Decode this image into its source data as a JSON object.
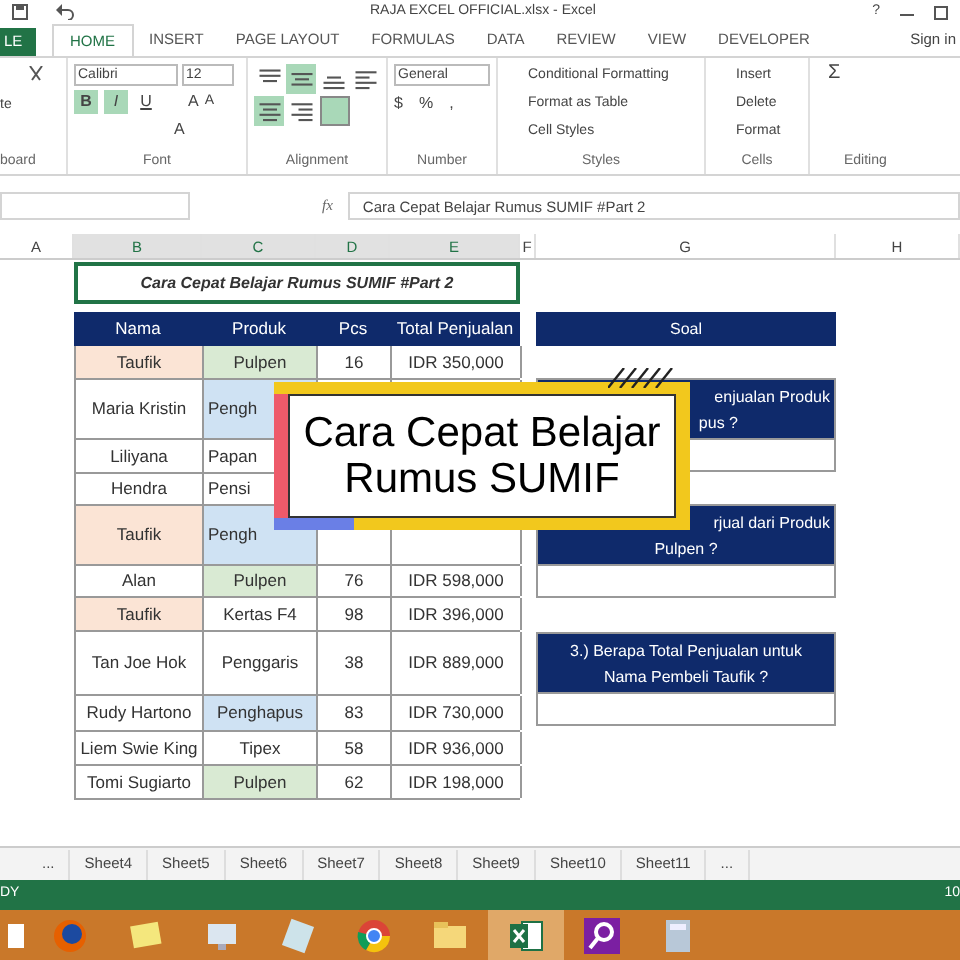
{
  "window": {
    "title": "RAJA EXCEL OFFICIAL.xlsx - Excel",
    "help": "?"
  },
  "file_tab": "LE",
  "tabs": [
    {
      "label": "HOME",
      "selected": true
    },
    {
      "label": "INSERT",
      "selected": false
    },
    {
      "label": "PAGE LAYOUT",
      "selected": false
    },
    {
      "label": "FORMULAS",
      "selected": false
    },
    {
      "label": "DATA",
      "selected": false
    },
    {
      "label": "REVIEW",
      "selected": false
    },
    {
      "label": "VIEW",
      "selected": false
    },
    {
      "label": "DEVELOPER",
      "selected": false
    }
  ],
  "sign_in": "Sign in",
  "ribbon": {
    "paste_label": "te",
    "font_name": "Calibri",
    "font_size": "12",
    "font_buttons": [
      {
        "label": "B",
        "active": true
      },
      {
        "label": "I",
        "active": true
      },
      {
        "label": "U",
        "active": false
      }
    ],
    "font_grow": [
      "A",
      "A"
    ],
    "font_color": "A",
    "align_buttons": [
      {
        "kind": "top",
        "active": false
      },
      {
        "kind": "middle",
        "active": true
      },
      {
        "kind": "bottom",
        "active": false
      },
      {
        "kind": "left",
        "active": false
      },
      {
        "kind": "center",
        "active": true
      },
      {
        "kind": "right",
        "active": false
      }
    ],
    "wrap_active": true,
    "number_format": "General",
    "currency": "$",
    "percent": "%",
    "comma": ",",
    "styles": [
      "Conditional Formatting",
      "Format as Table",
      "Cell Styles"
    ],
    "cells": [
      "Insert",
      "Delete",
      "Format"
    ],
    "autosum": "Σ",
    "groups": [
      "board",
      "Font",
      "Alignment",
      "Number",
      "Styles",
      "Cells",
      "Editing"
    ]
  },
  "function_label": "fx",
  "formula": "Cara Cepat Belajar Rumus SUMIF #Part 2",
  "columns": [
    {
      "label": "A",
      "selected": false
    },
    {
      "label": "B",
      "selected": true
    },
    {
      "label": "C",
      "selected": true
    },
    {
      "label": "D",
      "selected": true
    },
    {
      "label": "E",
      "selected": true
    },
    {
      "label": "F",
      "selected": false
    },
    {
      "label": "G",
      "selected": false
    },
    {
      "label": "H",
      "selected": false
    }
  ],
  "sheet_title": "Cara Cepat Belajar Rumus SUMIF #Part 2",
  "table": {
    "columns": [
      "Nama",
      "Produk",
      "Pcs",
      "Total Penjualan"
    ],
    "rows": [
      {
        "cells": [
          {
            "text": "Taufik",
            "color": "#fbe4d5"
          },
          {
            "text": "Pulpen",
            "color": "#d9ead3"
          },
          {
            "text": "16"
          },
          {
            "text": "IDR 350,000"
          }
        ]
      },
      {
        "cells": [
          {
            "text": "Maria Kristin"
          },
          {
            "text": "Pengh",
            "color": "#cfe2f3"
          },
          null,
          null
        ]
      },
      {
        "cells": [
          {
            "text": "Liliyana"
          },
          {
            "text": "Papan"
          },
          null,
          null
        ]
      },
      {
        "cells": [
          {
            "text": "Hendra"
          },
          {
            "text": "Pensi"
          },
          null,
          null
        ]
      },
      {
        "cells": [
          {
            "text": "Taufik",
            "color": "#fbe4d5"
          },
          {
            "text": "Pengh",
            "color": "#cfe2f3"
          },
          null,
          null
        ]
      },
      {
        "cells": [
          {
            "text": "Alan"
          },
          {
            "text": "Pulpen",
            "color": "#d9ead3"
          },
          {
            "text": "76"
          },
          {
            "text": "IDR 598,000"
          }
        ]
      },
      {
        "cells": [
          {
            "text": "Taufik",
            "color": "#fbe4d5"
          },
          {
            "text": "Kertas F4"
          },
          {
            "text": "98"
          },
          {
            "text": "IDR 396,000"
          }
        ]
      },
      {
        "cells": [
          {
            "text": "Tan Joe Hok"
          },
          {
            "text": "Penggaris"
          },
          {
            "text": "38"
          },
          {
            "text": "IDR 889,000"
          }
        ]
      },
      {
        "cells": [
          {
            "text": "Rudy Hartono"
          },
          {
            "text": "Penghapus",
            "color": "#cfe2f3"
          },
          {
            "text": "83"
          },
          {
            "text": "IDR 730,000"
          }
        ]
      },
      {
        "cells": [
          {
            "text": "Liem Swie King"
          },
          {
            "text": "Tipex"
          },
          {
            "text": "58"
          },
          {
            "text": "IDR 936,000"
          }
        ]
      },
      {
        "cells": [
          {
            "text": "Tomi Sugiarto"
          },
          {
            "text": "Pulpen",
            "color": "#d9ead3"
          },
          {
            "text": "62"
          },
          {
            "text": "IDR 198,000"
          }
        ]
      }
    ]
  },
  "questions": {
    "header": "Soal",
    "items": [
      {
        "lines": [
          "enjualan Produk",
          "pus ?"
        ]
      },
      {
        "lines": [
          "rjual dari Produk",
          "Pulpen ?"
        ]
      },
      {
        "lines": [
          "3.) Berapa Total Penjualan untuk",
          "Nama Pembeli Taufik ?"
        ]
      }
    ]
  },
  "title_card": "Cara Cepat Belajar Rumus SUMIF",
  "sheet_tabs": [
    "...",
    "Sheet4",
    "Sheet5",
    "Sheet6",
    "Sheet7",
    "Sheet8",
    "Sheet9",
    "Sheet10",
    "Sheet11",
    "..."
  ],
  "status": {
    "text": "DY",
    "zoom": "10"
  },
  "taskbar": [
    {
      "kind": "start",
      "selected": false
    },
    {
      "kind": "firefox",
      "selected": false
    },
    {
      "kind": "notes",
      "selected": false
    },
    {
      "kind": "monitor",
      "selected": false
    },
    {
      "kind": "paper",
      "selected": false
    },
    {
      "kind": "chrome",
      "selected": false
    },
    {
      "kind": "folder",
      "selected": false
    },
    {
      "kind": "excel",
      "selected": true
    },
    {
      "kind": "search",
      "selected": false
    },
    {
      "kind": "calculator",
      "selected": false
    }
  ]
}
